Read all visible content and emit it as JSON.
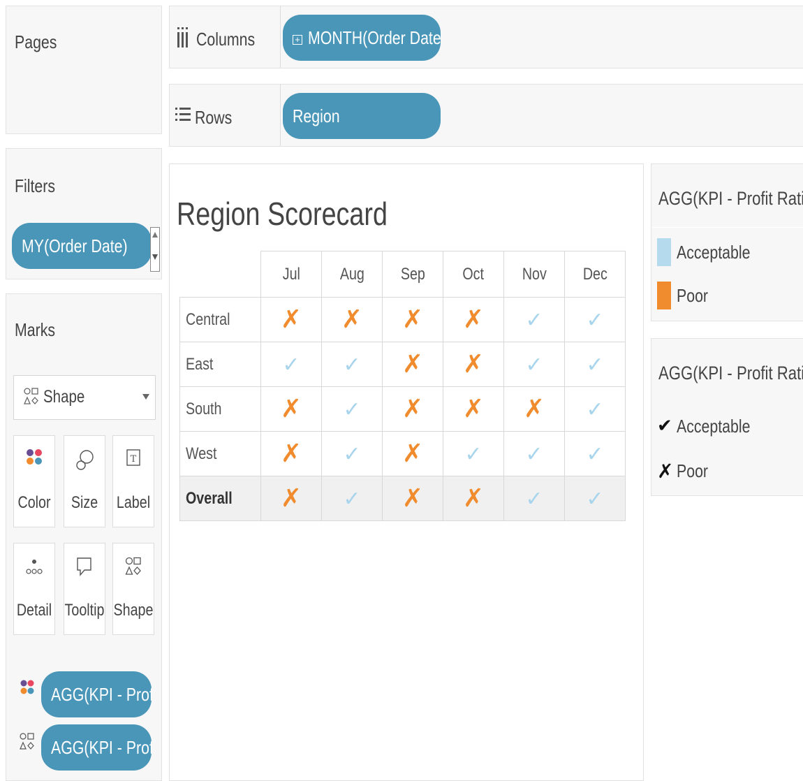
{
  "pages": {
    "title": "Pages"
  },
  "filters": {
    "title": "Filters",
    "pill": "MY(Order Date)"
  },
  "marks": {
    "title": "Marks",
    "mark_type": "Shape",
    "buttons": [
      {
        "label": "Color",
        "icon": "color-icon"
      },
      {
        "label": "Size",
        "icon": "size-icon"
      },
      {
        "label": "Label",
        "icon": "label-icon"
      },
      {
        "label": "Detail",
        "icon": "detail-icon"
      },
      {
        "label": "Tooltip",
        "icon": "tooltip-icon"
      },
      {
        "label": "Shape",
        "icon": "shape-icon"
      }
    ],
    "fields": [
      {
        "icon": "color-icon",
        "label": "AGG(KPI - Prof.."
      },
      {
        "icon": "shape-icon",
        "label": "AGG(KPI - Prof.."
      }
    ]
  },
  "shelves": {
    "columns_label": "Columns",
    "columns_pill": "MONTH(Order Date)",
    "rows_label": "Rows",
    "rows_pill": "Region"
  },
  "view": {
    "title": "Region Scorecard",
    "columns": [
      "Jul",
      "Aug",
      "Sep",
      "Oct",
      "Nov",
      "Dec"
    ],
    "rows": [
      {
        "name": "Central",
        "values": [
          "Poor",
          "Poor",
          "Poor",
          "Poor",
          "Acceptable",
          "Acceptable"
        ]
      },
      {
        "name": "East",
        "values": [
          "Acceptable",
          "Acceptable",
          "Poor",
          "Poor",
          "Acceptable",
          "Acceptable"
        ]
      },
      {
        "name": "South",
        "values": [
          "Poor",
          "Acceptable",
          "Poor",
          "Poor",
          "Poor",
          "Acceptable"
        ]
      },
      {
        "name": "West",
        "values": [
          "Poor",
          "Acceptable",
          "Poor",
          "Acceptable",
          "Acceptable",
          "Acceptable"
        ]
      },
      {
        "name": "Overall",
        "values": [
          "Poor",
          "Acceptable",
          "Poor",
          "Poor",
          "Acceptable",
          "Acceptable"
        ]
      }
    ]
  },
  "legends": {
    "color": {
      "title": "AGG(KPI - Profit Ratio)",
      "items": [
        {
          "label": "Acceptable",
          "color": "#b5daee"
        },
        {
          "label": "Poor",
          "color": "#f08c2e"
        }
      ]
    },
    "shape": {
      "title": "AGG(KPI - Profit Ratio)",
      "items": [
        {
          "label": "Acceptable",
          "icon": "checkmark-icon"
        },
        {
          "label": "Poor",
          "icon": "x-icon"
        }
      ]
    }
  },
  "colors": {
    "poor": "#f08c2e",
    "acceptable": "#a8d4ec",
    "pill": "#4a96b8"
  }
}
